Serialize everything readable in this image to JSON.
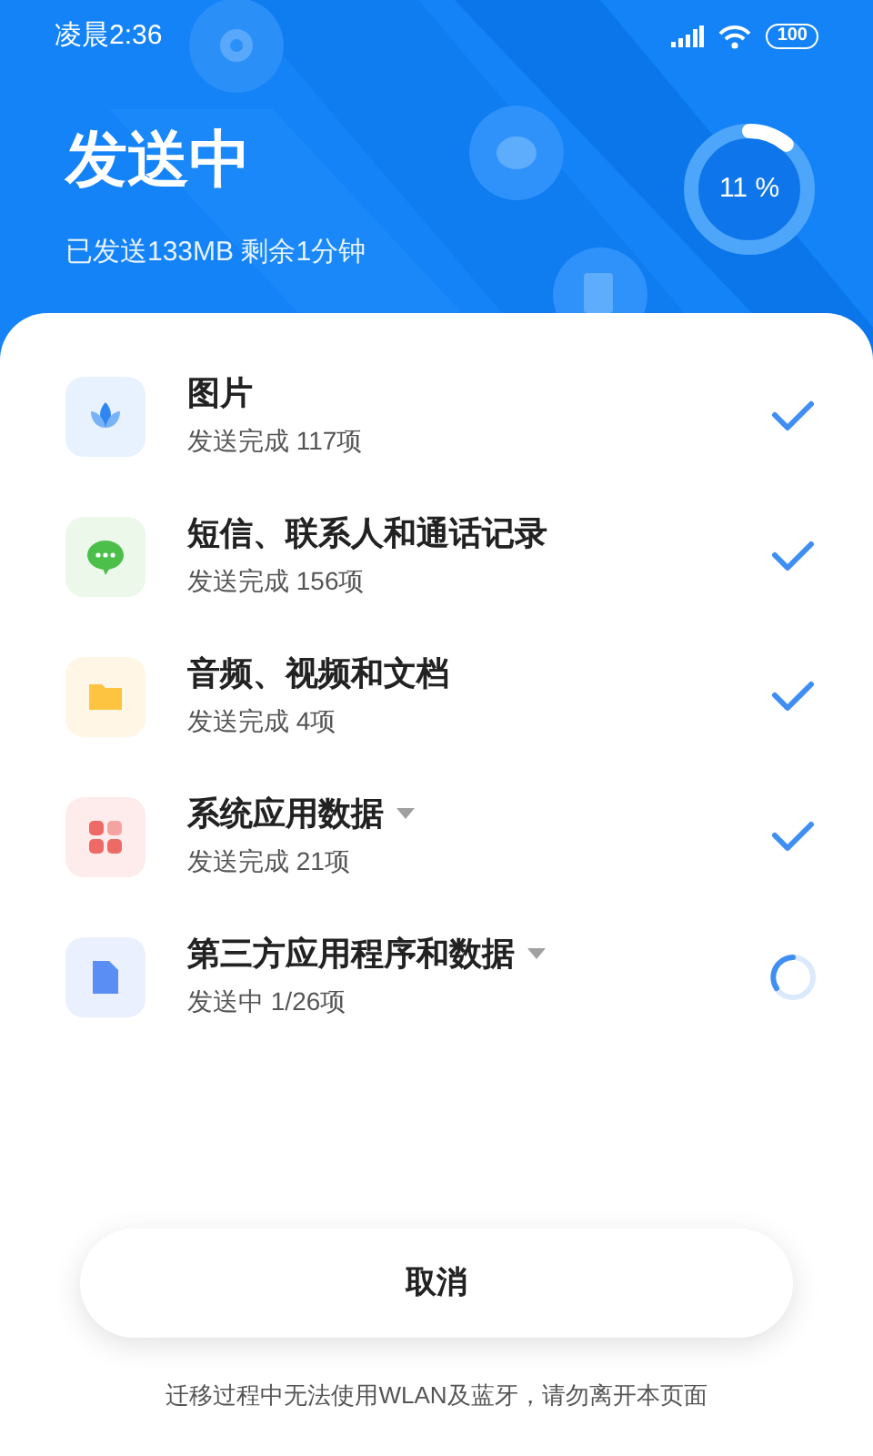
{
  "status_bar": {
    "time": "凌晨2:36",
    "battery": "100"
  },
  "header": {
    "title": "发送中",
    "subtitle": "已发送133MB 剩余1分钟",
    "progress": {
      "level": 0.11,
      "label": "11 %"
    }
  },
  "items": [
    {
      "kind": "photos",
      "title": "图片",
      "status": "发送完成 117项",
      "done": true,
      "expandable": false
    },
    {
      "kind": "messages",
      "title": "短信、联系人和通话记录",
      "status": "发送完成 156项",
      "done": true,
      "expandable": false
    },
    {
      "kind": "files",
      "title": "音频、视频和文档",
      "status": "发送完成 4项",
      "done": true,
      "expandable": false
    },
    {
      "kind": "system",
      "title": "系统应用数据",
      "status": "发送完成 21项",
      "done": true,
      "expandable": true
    },
    {
      "kind": "apps",
      "title": "第三方应用程序和数据",
      "status": "发送中 1/26项",
      "done": false,
      "expandable": true
    }
  ],
  "cancel_button": "取消",
  "footer_note": "迁移过程中无法使用WLAN及蓝牙，请勿离开本页面"
}
